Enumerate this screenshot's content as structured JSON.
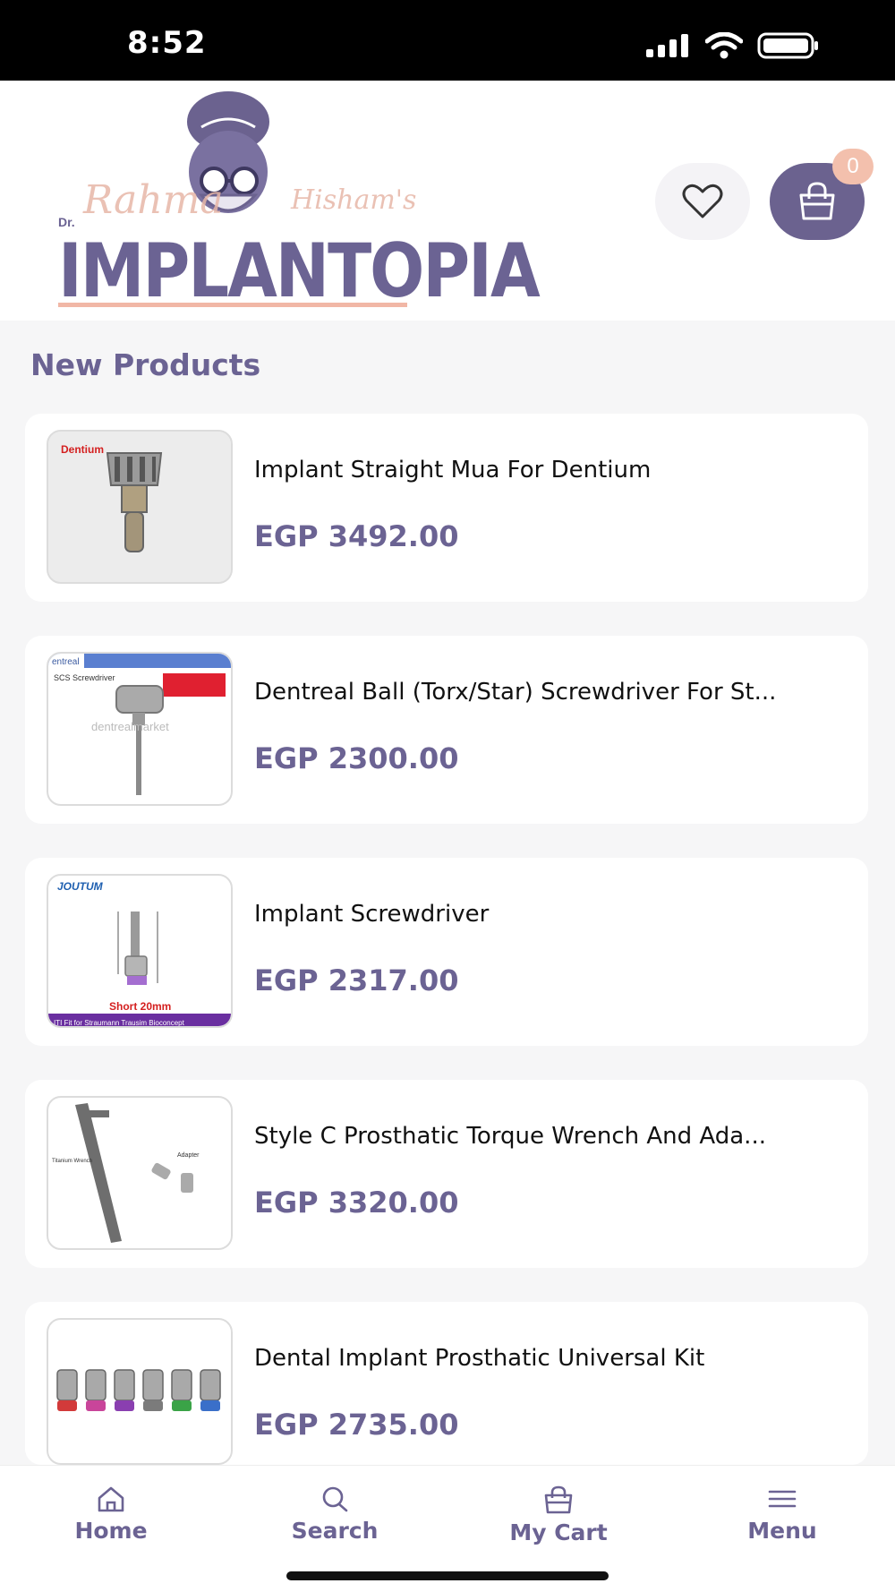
{
  "status_bar": {
    "time": "8:52"
  },
  "header": {
    "logo": {
      "prefix": "Dr.",
      "script_first": "Rahma",
      "script_last": "Hisham's",
      "wordmark": "IMPLANTOPIA"
    },
    "cart_count": "0"
  },
  "main": {
    "section_title": "New Products",
    "products": [
      {
        "name": "Implant Straight Mua For Dentium",
        "price": "EGP 3492.00",
        "brand": "Dentium"
      },
      {
        "name": "Dentreal Ball (Torx/Star) Screwdriver For St...",
        "price": "EGP 2300.00",
        "brand": "entreal",
        "caption": "SCS Screwdriver",
        "watermark": "dentrealmarket"
      },
      {
        "name": "Implant Screwdriver",
        "price": "EGP 2317.00",
        "brand": "JOUTUM",
        "caption": "Short 20mm",
        "footer": "ITI Fit for Straumann Trausim Bioconcept"
      },
      {
        "name": "Style C Prosthatic Torque Wrench And Ada...",
        "price": "EGP 3320.00",
        "labels": [
          "Titanium Wrench",
          "Adapter"
        ]
      },
      {
        "name": "Dental Implant Prosthatic Universal Kit",
        "price": "EGP 2735.00",
        "part_colors": [
          "#d23a3a",
          "#c9459a",
          "#8a3fb0",
          "#7b7b7b",
          "#3aa347",
          "#3a6fc9"
        ]
      }
    ]
  },
  "bottom_nav": {
    "items": [
      {
        "label": "Home",
        "icon": "home-icon"
      },
      {
        "label": "Search",
        "icon": "search-icon"
      },
      {
        "label": "My Cart",
        "icon": "bag-icon"
      },
      {
        "label": "Menu",
        "icon": "menu-icon"
      }
    ]
  },
  "colors": {
    "accent": "#6b6393",
    "badge": "#f3c0ad",
    "logo_pink": "#e7b7a8"
  }
}
